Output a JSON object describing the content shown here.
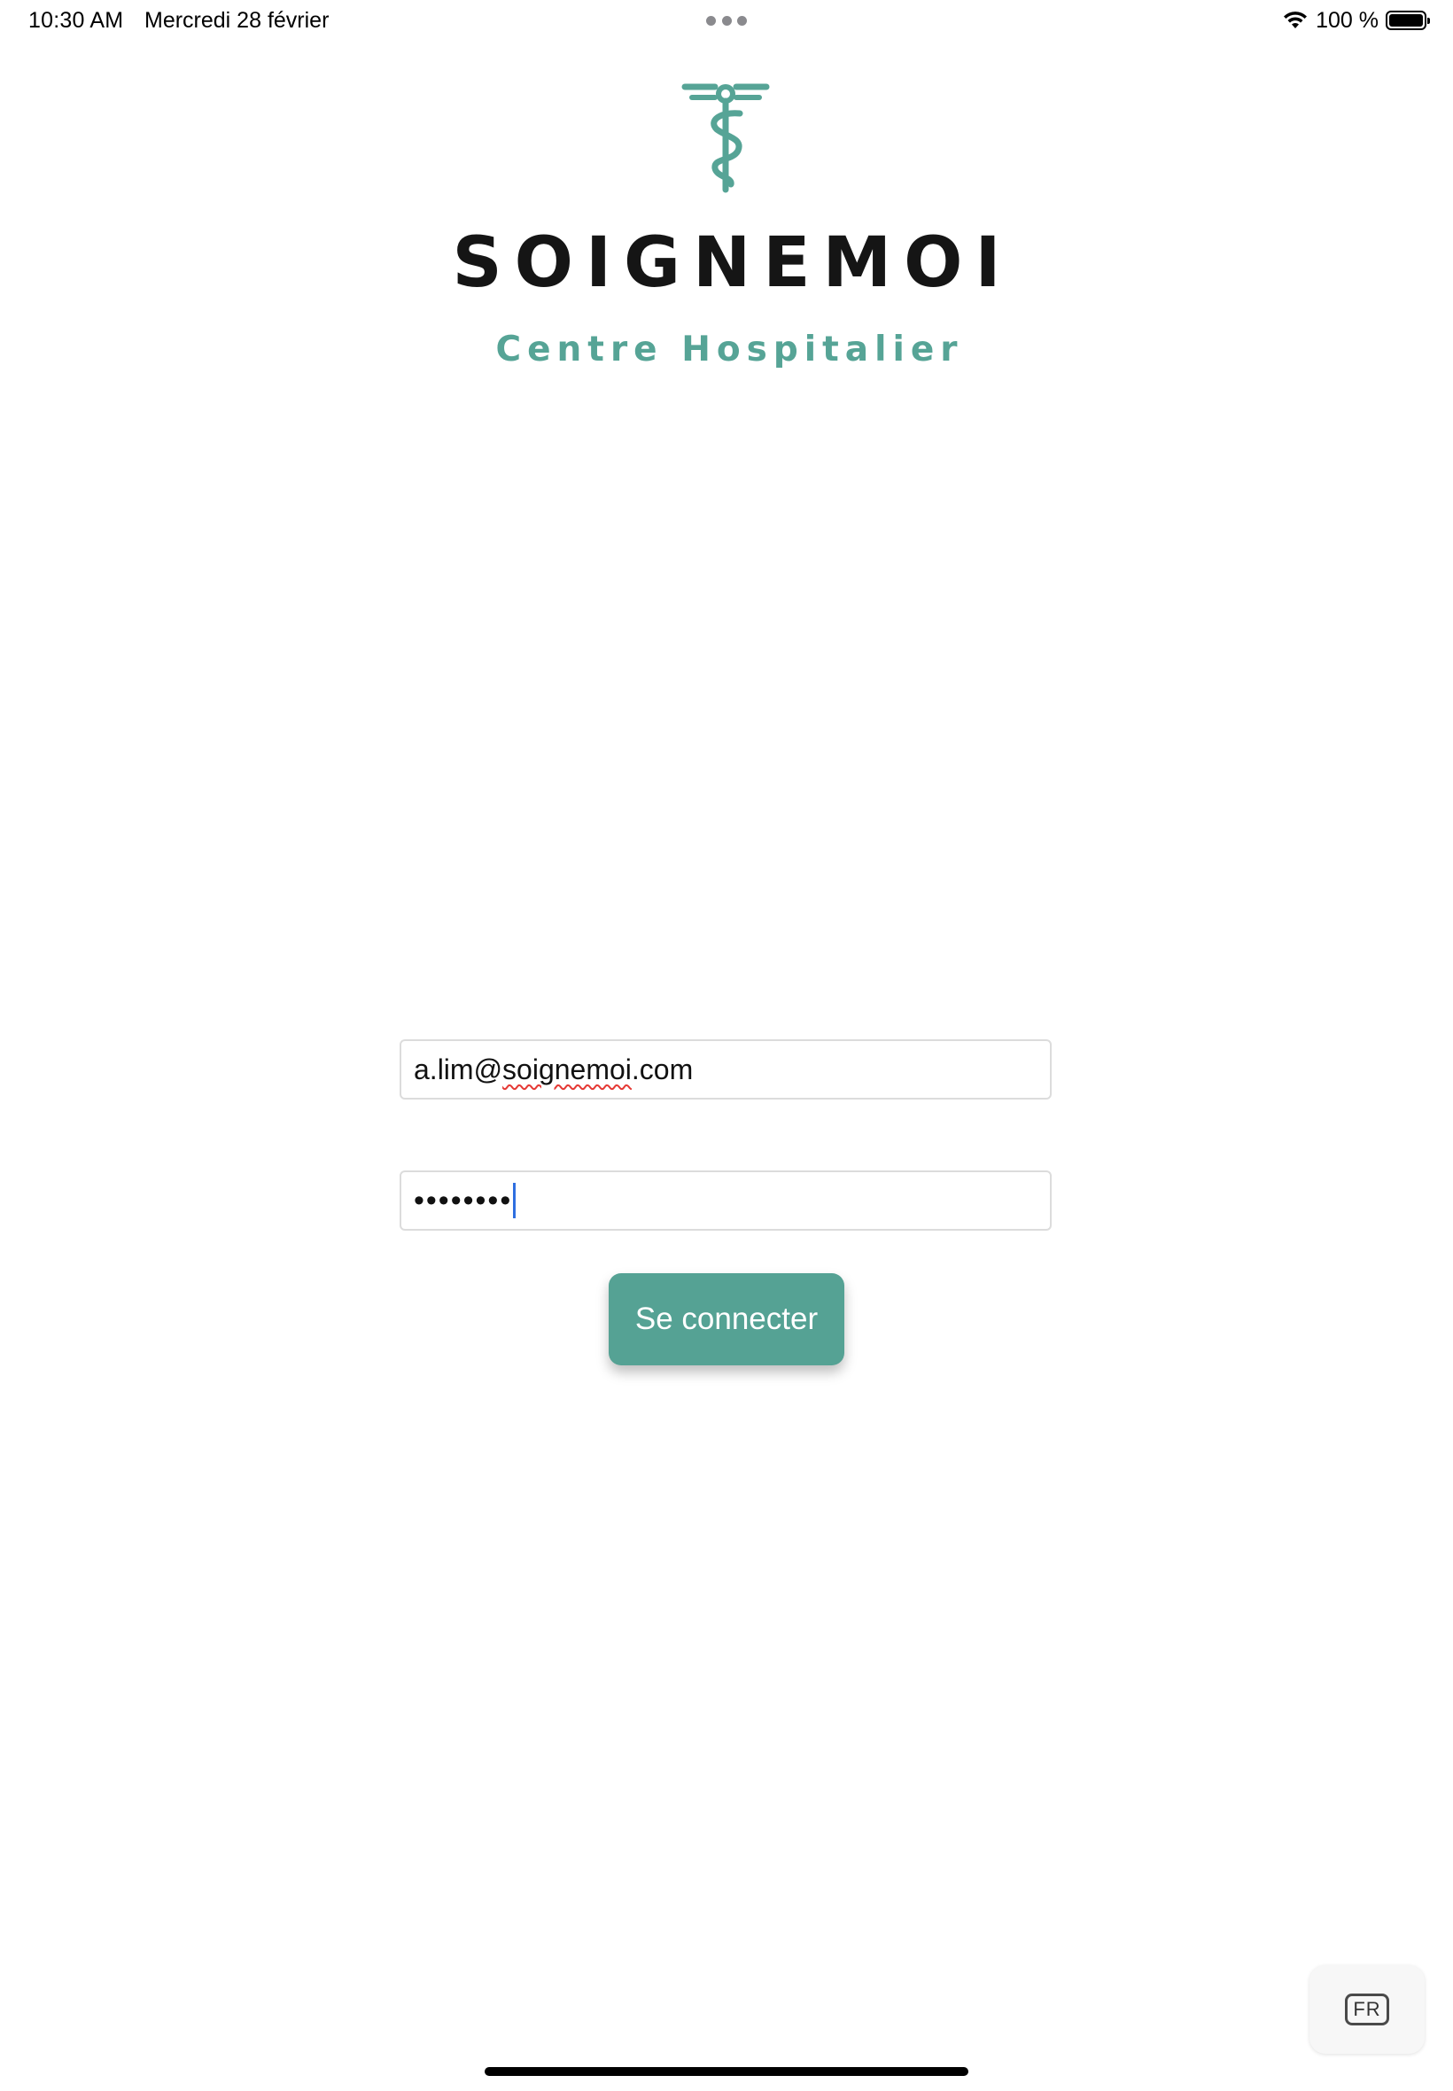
{
  "status_bar": {
    "time": "10:30 AM",
    "date": "Mercredi 28 février",
    "battery_percent": "100 %",
    "icons": [
      "multitasking-dots-icon",
      "wifi-icon",
      "battery-icon"
    ]
  },
  "logo": {
    "icon": "caduceus-icon",
    "brand_name": "SOIGNEMOI",
    "subtitle": "Centre Hospitalier",
    "accent_color": "#56a496"
  },
  "login_form": {
    "email_value": "a.lim@soignemoi.com",
    "email_prefix": "a.lim@",
    "email_misspelled": "soignemoi",
    "email_suffix": ".com",
    "password_masked": "••••••••",
    "submit_label": "Se connecter",
    "button_color": "#55a294"
  },
  "keyboard": {
    "language_label": "FR"
  }
}
